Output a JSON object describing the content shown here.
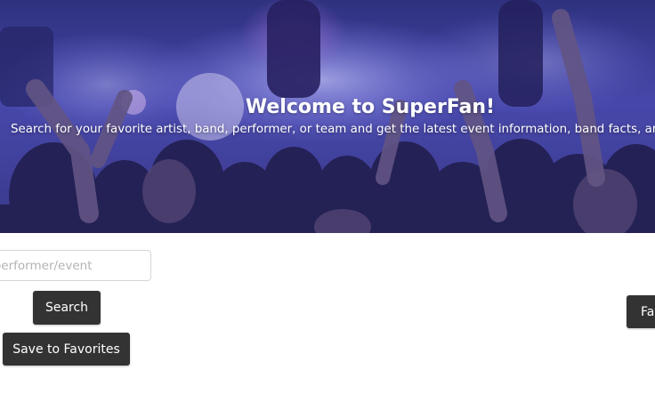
{
  "hero": {
    "title": "Welcome to SuperFan!",
    "subtitle": "Search for your favorite artist, band, performer, or team and get the latest event information, band facts, and m"
  },
  "search": {
    "placeholder": "artist/performer/event",
    "search_label": "Search",
    "save_label": "Save to Favorites"
  },
  "favorites": {
    "label": "Favorites"
  }
}
